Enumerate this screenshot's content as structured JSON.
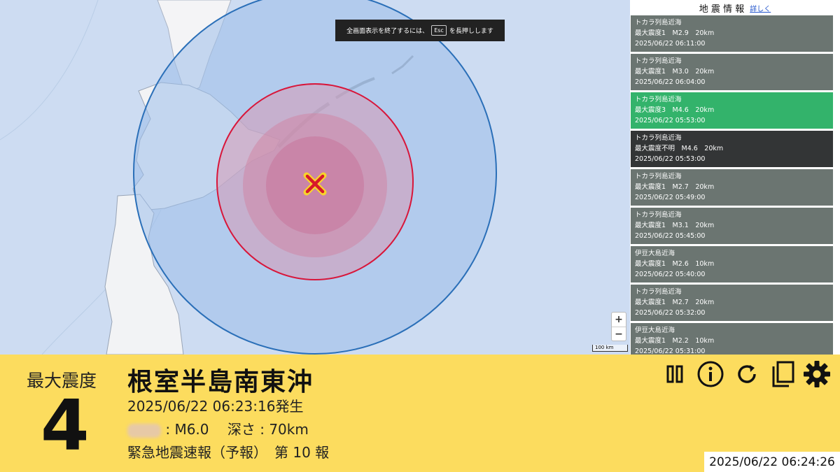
{
  "map": {
    "toast": {
      "text_before": "全画面表示を終了するには、",
      "key": "Esc",
      "text_after": "を長押しします"
    },
    "zoom_in_label": "+",
    "zoom_out_label": "−",
    "scale_label": "100 km",
    "epicenter_icon": "epicenter-cross-icon"
  },
  "sidebar": {
    "title": "地 震 情 報",
    "more_link": "詳しく",
    "items": [
      {
        "area": "トカラ列島近海",
        "detail": "最大震度1　M2.9　20km",
        "time": "2025/06/22 06:11:00"
      },
      {
        "area": "トカラ列島近海",
        "detail": "最大震度1　M3.0　20km",
        "time": "2025/06/22 06:04:00"
      },
      {
        "area": "トカラ列島近海",
        "detail": "最大震度3　M4.6　20km",
        "time": "2025/06/22 05:53:00"
      },
      {
        "area": "トカラ列島近海",
        "detail": "最大震度不明　M4.6　20km",
        "time": "2025/06/22 05:53:00"
      },
      {
        "area": "トカラ列島近海",
        "detail": "最大震度1　M2.7　20km",
        "time": "2025/06/22 05:49:00"
      },
      {
        "area": "トカラ列島近海",
        "detail": "最大震度1　M3.1　20km",
        "time": "2025/06/22 05:45:00"
      },
      {
        "area": "伊豆大島近海",
        "detail": "最大震度1　M2.6　10km",
        "time": "2025/06/22 05:40:00"
      },
      {
        "area": "トカラ列島近海",
        "detail": "最大震度1　M2.7　20km",
        "time": "2025/06/22 05:32:00"
      },
      {
        "area": "伊豆大島近海",
        "detail": "最大震度1　M2.2　10km",
        "time": "2025/06/22 05:31:00"
      }
    ],
    "colors": {
      "default": "#6b7571",
      "highlight": "#33b36b",
      "selected": "#333536"
    }
  },
  "panel": {
    "intensity_label": "最大震度",
    "intensity_value": "4",
    "region": "根室半島南東沖",
    "occurred": "2025/06/22 06:23:16発生",
    "magnitude_depth": " : M6.0　 深さ : 70km",
    "report": "緊急地震速報（予報）　第 10 報",
    "background": "#fcdc5e",
    "controls": [
      "pause-icon",
      "info-icon",
      "reload-icon",
      "copy-icon",
      "settings-gear-icon"
    ]
  },
  "clock": "2025/06/22 06:24:26"
}
